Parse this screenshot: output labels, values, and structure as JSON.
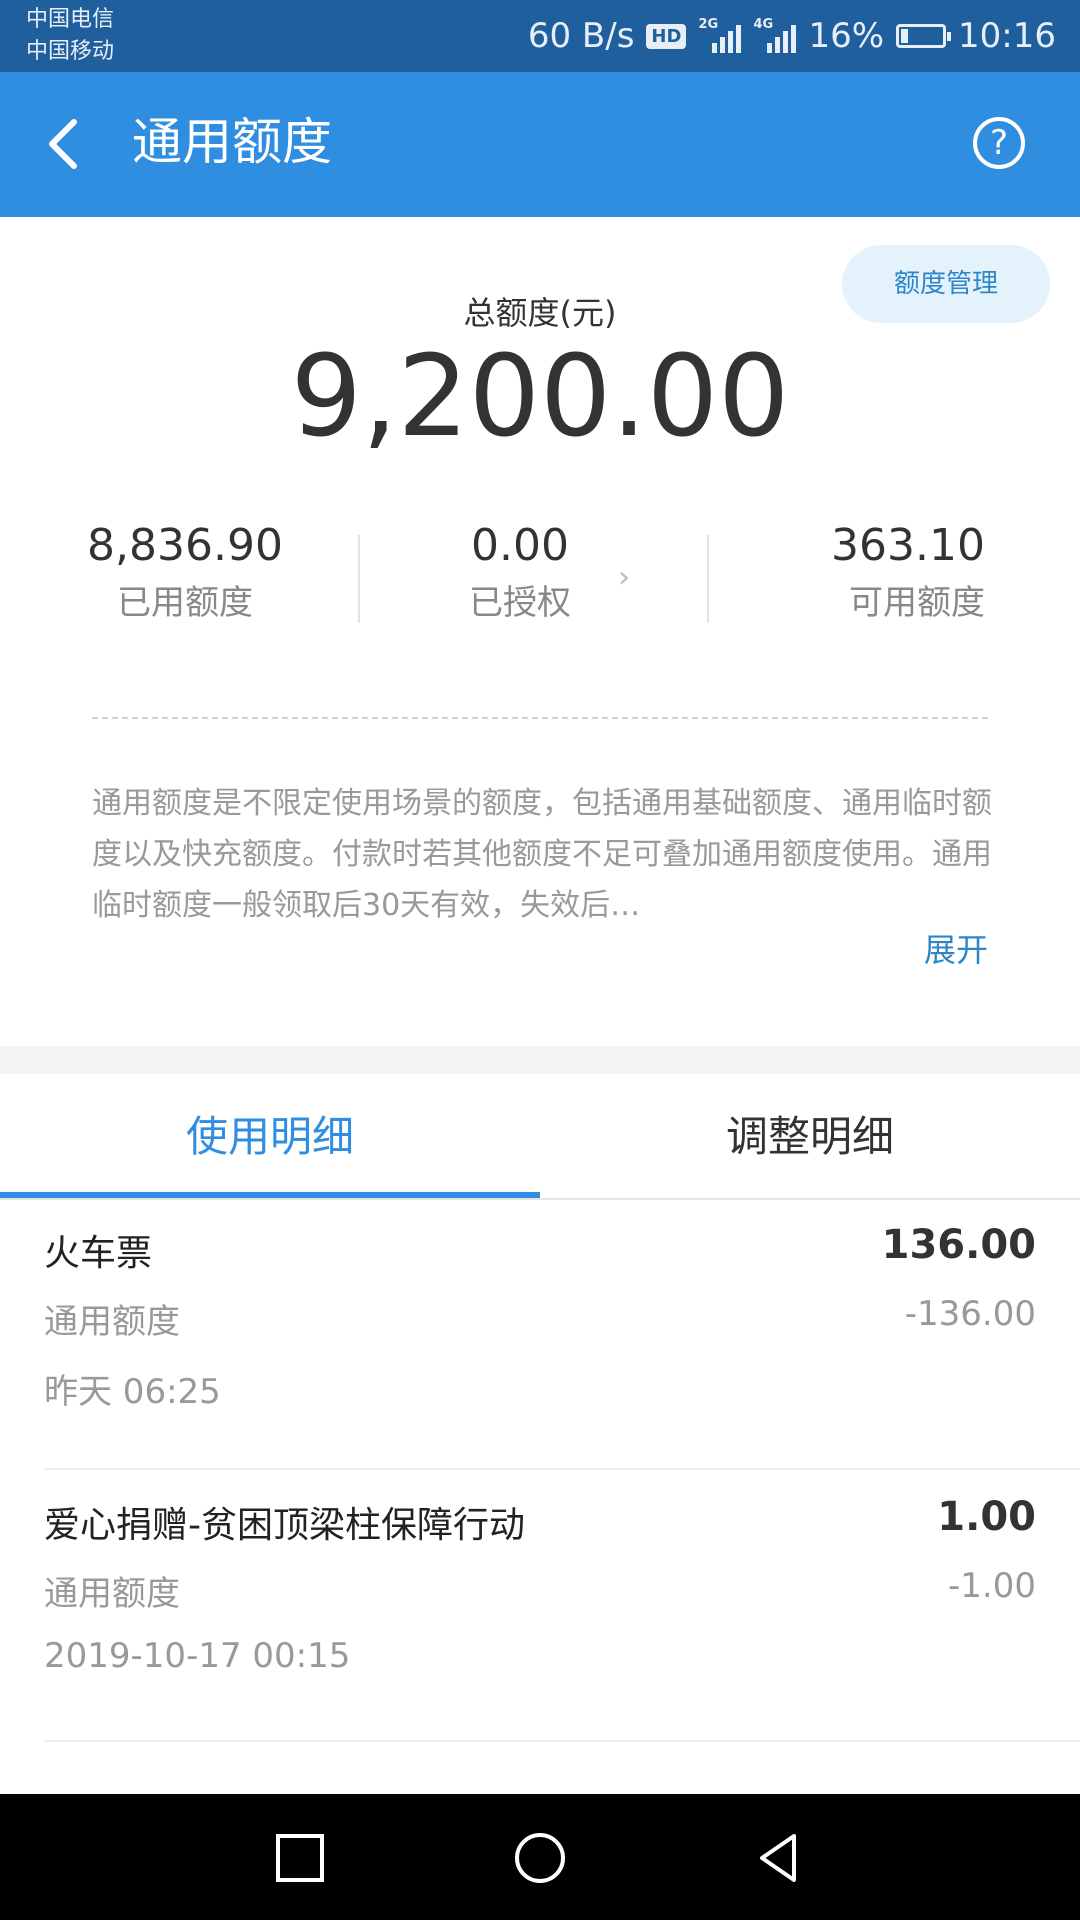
{
  "status_bar": {
    "carrier_1": "中国电信",
    "carrier_2": "中国移动",
    "net_speed": "60 B/s",
    "hd": "HD",
    "signal_1": "2G",
    "signal_2": "4G",
    "battery": "16%",
    "time": "10:16"
  },
  "header": {
    "title": "通用额度",
    "help_icon": "question-circle-icon",
    "back_icon": "chevron-left-icon"
  },
  "summary": {
    "manage_label": "额度管理",
    "total_label": "总额度(元)",
    "total_value": "9,200.00",
    "used_value": "8,836.90",
    "used_label": "已用额度",
    "authorized_value": "0.00",
    "authorized_label": "已授权",
    "available_value": "363.10",
    "available_label": "可用额度"
  },
  "description": {
    "text": "通用额度是不限定使用场景的额度，包括通用基础额度、通用临时额度以及快充额度。付款时若其他额度不足可叠加通用额度使用。通用临时额度一般领取后30天有效，失效后…",
    "expand_label": "展开"
  },
  "tabs": [
    {
      "label": "使用明细",
      "active": true
    },
    {
      "label": "调整明细",
      "active": false
    }
  ],
  "records": [
    {
      "name": "火车票",
      "amount": "136.00",
      "type": "通用额度",
      "delta": "-136.00",
      "time": "昨天 06:25"
    },
    {
      "name": "爱心捐赠-贫困顶梁柱保障行动",
      "amount": "1.00",
      "type": "通用额度",
      "delta": "-1.00",
      "time": "2019-10-17 00:15"
    }
  ],
  "colors": {
    "status_bar": "#1f5f9e",
    "accent": "#2f8ee0",
    "link": "#2d86c8"
  }
}
